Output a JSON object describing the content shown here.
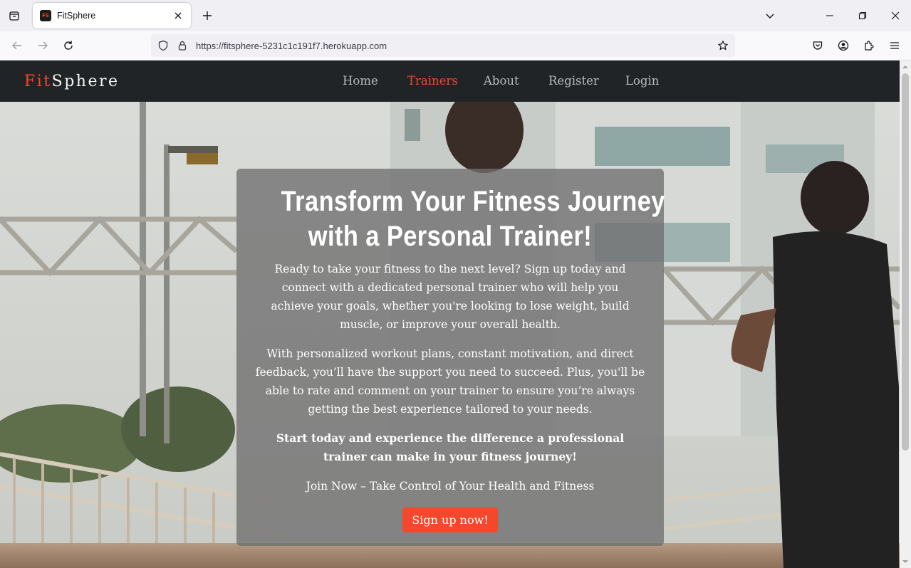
{
  "browser": {
    "tab_title": "FitSphere",
    "favicon_text": "FS",
    "url": "https://fitsphere-5231c1c191f7.herokuapp.com"
  },
  "site": {
    "brand_accent": "Fit",
    "brand_rest": "Sphere",
    "nav": [
      {
        "label": "Home",
        "active": false
      },
      {
        "label": "Trainers",
        "active": true
      },
      {
        "label": "About",
        "active": false
      },
      {
        "label": "Register",
        "active": false
      },
      {
        "label": "Login",
        "active": false
      }
    ],
    "accent_color": "#f5472c"
  },
  "hero": {
    "title_line1": "Transform Your Fitness Journey",
    "title_line2": "with a Personal Trainer!",
    "p1": "Ready to take your fitness to the next level? Sign up today and connect with a dedicated personal trainer who will help you achieve your goals, whether you're looking to lose weight, build muscle, or improve your overall health.",
    "p2": "With personalized workout plans, constant motivation, and direct feedback, you’ll have the support you need to succeed. Plus, you'll be able to rate and comment on your trainer to ensure you’re always getting the best experience tailored to your needs.",
    "p3": "Start today and experience the difference a professional trainer can make in your fitness journey!",
    "p4": "Join Now – Take Control of Your Health and Fitness",
    "cta_label": "Sign up now!"
  }
}
